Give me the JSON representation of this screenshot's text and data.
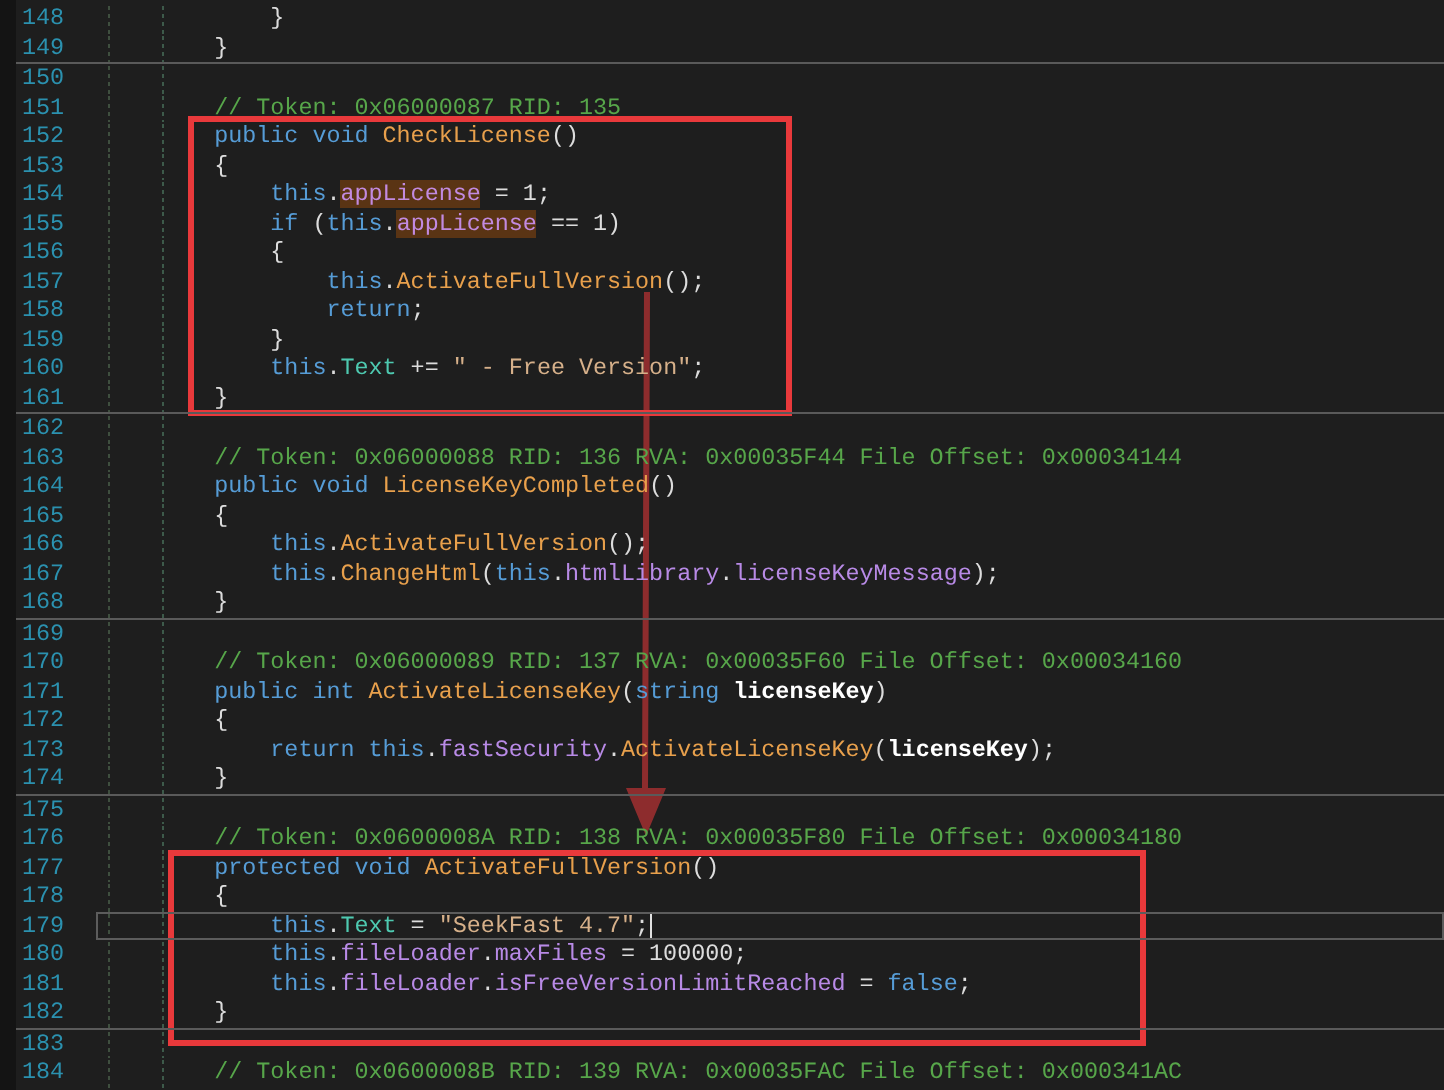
{
  "editor": {
    "blocks": [
      {
        "lines": [
          {
            "number": "148",
            "current": false,
            "tokens": [
              {
                "kind": "plain",
                "text": "            }"
              }
            ]
          },
          {
            "number": "149",
            "current": false,
            "tokens": [
              {
                "kind": "plain",
                "text": "        }"
              }
            ]
          }
        ]
      },
      {
        "lines": [
          {
            "number": "150",
            "current": false
          },
          {
            "number": "151",
            "current": false,
            "tokens": [
              {
                "kind": "comment",
                "text": "        // Token: 0x06000087 RID: 135"
              }
            ]
          },
          {
            "number": "152",
            "current": false,
            "tokens": [
              {
                "kind": "keyword",
                "text": "        public void "
              },
              {
                "kind": "method",
                "text": "CheckLicense"
              },
              {
                "kind": "plain",
                "text": "()"
              }
            ]
          },
          {
            "number": "153",
            "current": false,
            "tokens": [
              {
                "kind": "plain",
                "text": "        {"
              }
            ]
          },
          {
            "number": "154",
            "current": false,
            "tokens": [
              {
                "kind": "keyword",
                "text": "            this"
              },
              {
                "kind": "plain",
                "text": "."
              },
              {
                "kind": "field-highlight",
                "text": "appLicense"
              },
              {
                "kind": "plain",
                "text": " = "
              },
              {
                "kind": "number",
                "text": "1"
              },
              {
                "kind": "plain",
                "text": ";"
              }
            ]
          },
          {
            "number": "155",
            "current": false,
            "tokens": [
              {
                "kind": "keyword",
                "text": "            if"
              },
              {
                "kind": "plain",
                "text": " ("
              },
              {
                "kind": "keyword",
                "text": "this"
              },
              {
                "kind": "plain",
                "text": "."
              },
              {
                "kind": "field-highlight",
                "text": "appLicense"
              },
              {
                "kind": "plain",
                "text": " == "
              },
              {
                "kind": "number",
                "text": "1"
              },
              {
                "kind": "plain",
                "text": ")"
              }
            ]
          },
          {
            "number": "156",
            "current": false,
            "tokens": [
              {
                "kind": "plain",
                "text": "            {"
              }
            ]
          },
          {
            "number": "157",
            "current": false,
            "tokens": [
              {
                "kind": "keyword",
                "text": "                this"
              },
              {
                "kind": "plain",
                "text": "."
              },
              {
                "kind": "method",
                "text": "ActivateFullVersion"
              },
              {
                "kind": "plain",
                "text": "();"
              }
            ]
          },
          {
            "number": "158",
            "current": false,
            "tokens": [
              {
                "kind": "keyword",
                "text": "                return"
              },
              {
                "kind": "plain",
                "text": ";"
              }
            ]
          },
          {
            "number": "159",
            "current": false,
            "tokens": [
              {
                "kind": "plain",
                "text": "            }"
              }
            ]
          },
          {
            "number": "160",
            "current": false,
            "tokens": [
              {
                "kind": "keyword",
                "text": "            this"
              },
              {
                "kind": "plain",
                "text": "."
              },
              {
                "kind": "property",
                "text": "Text"
              },
              {
                "kind": "plain",
                "text": " += "
              },
              {
                "kind": "string",
                "text": "\" - Free Version\""
              },
              {
                "kind": "plain",
                "text": ";"
              }
            ]
          },
          {
            "number": "161",
            "current": false,
            "tokens": [
              {
                "kind": "plain",
                "text": "        }"
              }
            ]
          }
        ]
      },
      {
        "lines": [
          {
            "number": "162",
            "current": false
          },
          {
            "number": "163",
            "current": false,
            "tokens": [
              {
                "kind": "comment",
                "text": "        // Token: 0x06000088 RID: 136 RVA: 0x00035F44 File Offset: 0x00034144"
              }
            ]
          },
          {
            "number": "164",
            "current": false,
            "tokens": [
              {
                "kind": "keyword",
                "text": "        public void "
              },
              {
                "kind": "method",
                "text": "LicenseKeyCompleted"
              },
              {
                "kind": "plain",
                "text": "()"
              }
            ]
          },
          {
            "number": "165",
            "current": false,
            "tokens": [
              {
                "kind": "plain",
                "text": "        {"
              }
            ]
          },
          {
            "number": "166",
            "current": false,
            "tokens": [
              {
                "kind": "keyword",
                "text": "            this"
              },
              {
                "kind": "plain",
                "text": "."
              },
              {
                "kind": "method",
                "text": "ActivateFullVersion"
              },
              {
                "kind": "plain",
                "text": "();"
              }
            ]
          },
          {
            "number": "167",
            "current": false,
            "tokens": [
              {
                "kind": "keyword",
                "text": "            this"
              },
              {
                "kind": "plain",
                "text": "."
              },
              {
                "kind": "method",
                "text": "ChangeHtml"
              },
              {
                "kind": "plain",
                "text": "("
              },
              {
                "kind": "keyword",
                "text": "this"
              },
              {
                "kind": "plain",
                "text": "."
              },
              {
                "kind": "field",
                "text": "htmlLibrary"
              },
              {
                "kind": "plain",
                "text": "."
              },
              {
                "kind": "field",
                "text": "licenseKeyMessage"
              },
              {
                "kind": "plain",
                "text": ");"
              }
            ]
          },
          {
            "number": "168",
            "current": false,
            "tokens": [
              {
                "kind": "plain",
                "text": "        }"
              }
            ]
          }
        ]
      },
      {
        "lines": [
          {
            "number": "169",
            "current": false
          },
          {
            "number": "170",
            "current": false,
            "tokens": [
              {
                "kind": "comment",
                "text": "        // Token: 0x06000089 RID: 137 RVA: 0x00035F60 File Offset: 0x00034160"
              }
            ]
          },
          {
            "number": "171",
            "current": false,
            "tokens": [
              {
                "kind": "keyword",
                "text": "        public int "
              },
              {
                "kind": "method",
                "text": "ActivateLicenseKey"
              },
              {
                "kind": "plain",
                "text": "("
              },
              {
                "kind": "keyword",
                "text": "string "
              },
              {
                "kind": "parameter",
                "text": "licenseKey"
              },
              {
                "kind": "plain",
                "text": ")"
              }
            ]
          },
          {
            "number": "172",
            "current": false,
            "tokens": [
              {
                "kind": "plain",
                "text": "        {"
              }
            ]
          },
          {
            "number": "173",
            "current": false,
            "tokens": [
              {
                "kind": "keyword",
                "text": "            return this"
              },
              {
                "kind": "plain",
                "text": "."
              },
              {
                "kind": "field",
                "text": "fastSecurity"
              },
              {
                "kind": "plain",
                "text": "."
              },
              {
                "kind": "method",
                "text": "ActivateLicenseKey"
              },
              {
                "kind": "plain",
                "text": "("
              },
              {
                "kind": "parameter",
                "text": "licenseKey"
              },
              {
                "kind": "plain",
                "text": ");"
              }
            ]
          },
          {
            "number": "174",
            "current": false,
            "tokens": [
              {
                "kind": "plain",
                "text": "        }"
              }
            ]
          }
        ]
      },
      {
        "lines": [
          {
            "number": "175",
            "current": false
          },
          {
            "number": "176",
            "current": false,
            "tokens": [
              {
                "kind": "comment",
                "text": "        // Token: 0x0600008A RID: 138 RVA: 0x00035F80 File Offset: 0x00034180"
              }
            ]
          },
          {
            "number": "177",
            "current": false,
            "tokens": [
              {
                "kind": "keyword",
                "text": "        protected void "
              },
              {
                "kind": "method",
                "text": "ActivateFullVersion"
              },
              {
                "kind": "plain",
                "text": "()"
              }
            ]
          },
          {
            "number": "178",
            "current": false,
            "tokens": [
              {
                "kind": "plain",
                "text": "        {"
              }
            ]
          },
          {
            "number": "179",
            "current": true,
            "tokens": [
              {
                "kind": "keyword",
                "text": "            this"
              },
              {
                "kind": "plain",
                "text": "."
              },
              {
                "kind": "property",
                "text": "Text"
              },
              {
                "kind": "plain",
                "text": " = "
              },
              {
                "kind": "string",
                "text": "\"SeekFast 4.7\""
              },
              {
                "kind": "plain",
                "text": ";"
              }
            ]
          },
          {
            "number": "180",
            "current": false,
            "tokens": [
              {
                "kind": "keyword",
                "text": "            this"
              },
              {
                "kind": "plain",
                "text": "."
              },
              {
                "kind": "field",
                "text": "fileLoader"
              },
              {
                "kind": "plain",
                "text": "."
              },
              {
                "kind": "field",
                "text": "maxFiles"
              },
              {
                "kind": "plain",
                "text": " = "
              },
              {
                "kind": "number",
                "text": "100000"
              },
              {
                "kind": "plain",
                "text": ";"
              }
            ]
          },
          {
            "number": "181",
            "current": false,
            "tokens": [
              {
                "kind": "keyword",
                "text": "            this"
              },
              {
                "kind": "plain",
                "text": "."
              },
              {
                "kind": "field",
                "text": "fileLoader"
              },
              {
                "kind": "plain",
                "text": "."
              },
              {
                "kind": "field",
                "text": "isFreeVersionLimitReached"
              },
              {
                "kind": "plain",
                "text": " = "
              },
              {
                "kind": "keyword",
                "text": "false"
              },
              {
                "kind": "plain",
                "text": ";"
              }
            ]
          },
          {
            "number": "182",
            "current": false,
            "tokens": [
              {
                "kind": "plain",
                "text": "        }"
              }
            ]
          }
        ]
      },
      {
        "lines": [
          {
            "number": "183",
            "current": false
          },
          {
            "number": "184",
            "current": false,
            "tokens": [
              {
                "kind": "comment",
                "text": "        // Token: 0x0600008B RID: 139 RVA: 0x00035FAC File Offset: 0x000341AC"
              }
            ]
          }
        ]
      }
    ]
  }
}
